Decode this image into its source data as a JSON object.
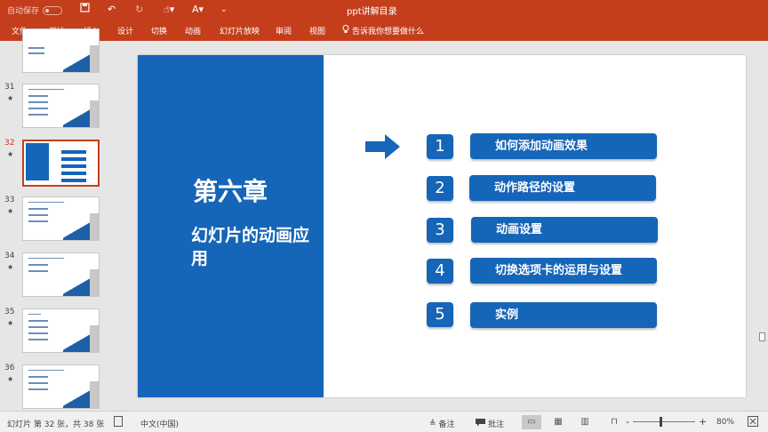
{
  "titlebar": {
    "autosave_label": "自动保存",
    "autosave_state": "关",
    "doc_title": "ppt讲解目录",
    "save_icon": "save-icon",
    "undo_icon": "undo-icon",
    "redo_icon": "redo-icon"
  },
  "ribbon": {
    "tabs": [
      "文件",
      "开始",
      "插入",
      "设计",
      "切换",
      "动画",
      "幻灯片放映",
      "审阅",
      "视图"
    ],
    "tell_me": "告诉我你想要做什么"
  },
  "thumbnails": [
    {
      "number": "",
      "star": ""
    },
    {
      "number": "31",
      "star": "★"
    },
    {
      "number": "32",
      "star": "★"
    },
    {
      "number": "33",
      "star": "★"
    },
    {
      "number": "34",
      "star": "★"
    },
    {
      "number": "35",
      "star": "★"
    },
    {
      "number": "36",
      "star": "★"
    }
  ],
  "slide": {
    "chapter": "第六章",
    "subtitle": "幻灯片的动画应用",
    "items": [
      {
        "num": "1",
        "label": "如何添加动画效果"
      },
      {
        "num": "2",
        "label": "动作路径的设置"
      },
      {
        "num": "3",
        "label": "动画设置"
      },
      {
        "num": "4",
        "label": "切换选项卡的运用与设置"
      },
      {
        "num": "5",
        "label": "实例"
      }
    ]
  },
  "statusbar": {
    "slide_info": "幻灯片 第 32 张，共 38 张",
    "language": "中文(中国)",
    "notes": "备注",
    "comments": "批注",
    "zoom_minus": "-",
    "zoom_plus": "+",
    "zoom": "80%"
  },
  "colors": {
    "accent": "#c43e1c",
    "slide_blue": "#1565b8"
  }
}
